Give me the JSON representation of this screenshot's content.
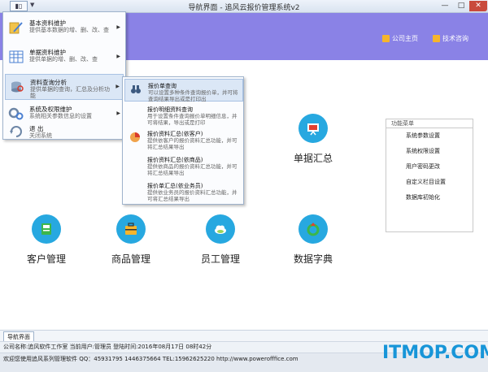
{
  "window": {
    "title": "导航界面 - 追风云报价管理系统v2",
    "min": "—",
    "max": "□",
    "close": "✕"
  },
  "quick_access": {
    "label": "▮▯",
    "arrow": "▼"
  },
  "header": {
    "home_link": "公司主页",
    "support_link": "技术咨询"
  },
  "func_panel": {
    "title": "功能菜单",
    "items": [
      "系统参数设置",
      "系统权限设置",
      "用户密码更改",
      "自定义栏目设置",
      "数据库初始化"
    ]
  },
  "modules": {
    "summary": "单据汇总",
    "customer": "客户管理",
    "product": "商品管理",
    "staff": "员工管理",
    "dictionary": "数据字典"
  },
  "menu": {
    "items": [
      {
        "title": "基本资料维护",
        "desc": "提供基本数据的增、删、改、查",
        "arrow": "▶"
      },
      {
        "title": "单据资料维护",
        "desc": "提供单据的增、删、改、查",
        "arrow": "▶"
      },
      {
        "title": "资料查询分析",
        "desc": "提供单据的查询，汇总及分析功能",
        "arrow": "▶"
      },
      {
        "title": "系统及权限维护",
        "desc": "系统相关参数信息的设置",
        "arrow": "▶"
      },
      {
        "title": "退 出",
        "desc": "关闭系统",
        "arrow": ""
      }
    ]
  },
  "submenu": {
    "items": [
      {
        "title": "报价单查询",
        "desc": "可以设置多种条件查询报价单，并可将查询结果导出或是打印出"
      },
      {
        "title": "报价明细资料查询",
        "desc": "用于设置条件查询报价单明细信息，并可将结果，导出或是打印"
      },
      {
        "title": "报价资料汇总(依客户)",
        "desc": "提供依客户的报价资料汇总功能，并可将汇总结果导出"
      },
      {
        "title": "报价资料汇总(依商品)",
        "desc": "提供依商品的报价资料汇总功能，并可将汇总结果导出"
      },
      {
        "title": "报价单汇总(依业务员)",
        "desc": "提供依业务员的报价资料汇总功能，并可将汇总结果导出"
      }
    ]
  },
  "tabbar": {
    "tab": "导航界面"
  },
  "status": {
    "line1": "公司名称:追风软件工作室 当前用户:管理员 登陆时间:2016年08月17日 08时42分",
    "line2": "欢迎您使用追风系列管理软件 QQ：45931795 1446375664 TEL:15962625220 http://www.powerofffice.com"
  },
  "watermark": "ITMOP.COM",
  "colors": {
    "header": "#8a82e6",
    "summary_icon": "#27a8e0",
    "customer_icon": "#27a8e0",
    "product_icon": "#27a8e0",
    "staff_icon": "#27a8e0",
    "dictionary_icon": "#27a8e0"
  }
}
